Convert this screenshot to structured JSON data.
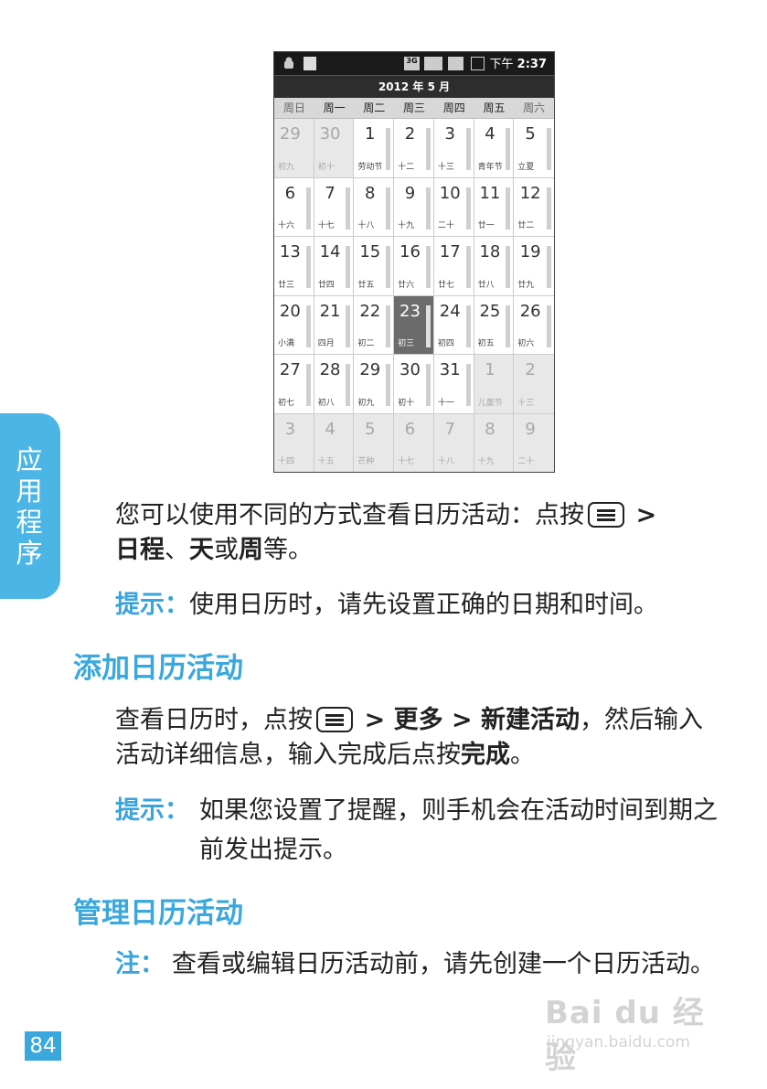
{
  "phone": {
    "statusbar": {
      "network": "3G",
      "time_prefix": "下午",
      "time": "2:37"
    },
    "month_title": "2012 年 5 月",
    "weekdays": [
      "周日",
      "周一",
      "周二",
      "周三",
      "周四",
      "周五",
      "周六"
    ],
    "weeks": [
      [
        {
          "d": "29",
          "l": "初九",
          "o": true
        },
        {
          "d": "30",
          "l": "初十",
          "o": true
        },
        {
          "d": "1",
          "l": "劳动节"
        },
        {
          "d": "2",
          "l": "十二"
        },
        {
          "d": "3",
          "l": "十三"
        },
        {
          "d": "4",
          "l": "青年节"
        },
        {
          "d": "5",
          "l": "立夏"
        }
      ],
      [
        {
          "d": "6",
          "l": "十六"
        },
        {
          "d": "7",
          "l": "十七"
        },
        {
          "d": "8",
          "l": "十八"
        },
        {
          "d": "9",
          "l": "十九"
        },
        {
          "d": "10",
          "l": "二十"
        },
        {
          "d": "11",
          "l": "廿一"
        },
        {
          "d": "12",
          "l": "廿二"
        }
      ],
      [
        {
          "d": "13",
          "l": "廿三"
        },
        {
          "d": "14",
          "l": "廿四"
        },
        {
          "d": "15",
          "l": "廿五"
        },
        {
          "d": "16",
          "l": "廿六"
        },
        {
          "d": "17",
          "l": "廿七"
        },
        {
          "d": "18",
          "l": "廿八"
        },
        {
          "d": "19",
          "l": "廿九"
        }
      ],
      [
        {
          "d": "20",
          "l": "小满"
        },
        {
          "d": "21",
          "l": "四月"
        },
        {
          "d": "22",
          "l": "初二"
        },
        {
          "d": "23",
          "l": "初三",
          "t": true
        },
        {
          "d": "24",
          "l": "初四"
        },
        {
          "d": "25",
          "l": "初五"
        },
        {
          "d": "26",
          "l": "初六"
        }
      ],
      [
        {
          "d": "27",
          "l": "初七"
        },
        {
          "d": "28",
          "l": "初八"
        },
        {
          "d": "29",
          "l": "初九"
        },
        {
          "d": "30",
          "l": "初十"
        },
        {
          "d": "31",
          "l": "十一"
        },
        {
          "d": "1",
          "l": "儿童节",
          "o": true
        },
        {
          "d": "2",
          "l": "十三",
          "o": true
        }
      ],
      [
        {
          "d": "3",
          "l": "十四",
          "o": true
        },
        {
          "d": "4",
          "l": "十五",
          "o": true
        },
        {
          "d": "5",
          "l": "芒种",
          "o": true
        },
        {
          "d": "6",
          "l": "十七",
          "o": true
        },
        {
          "d": "7",
          "l": "十八",
          "o": true
        },
        {
          "d": "8",
          "l": "十九",
          "o": true
        },
        {
          "d": "9",
          "l": "二十",
          "o": true
        }
      ]
    ]
  },
  "sidetab": "应用程序",
  "intro": {
    "p1": "您可以使用不同的方式查看日历活动：点按",
    "p2": ">",
    "p3": "日程",
    "p4": "、",
    "p5": "天",
    "p6": "或",
    "p7": "周",
    "p8": "等。"
  },
  "tip1": {
    "label": "提示：",
    "text": "使用日历时，请先设置正确的日期和时间。"
  },
  "section1": {
    "heading": "添加日历活动",
    "p1": "查看日历时，点按",
    "p2": "> 更多 > 新建活动",
    "p3": "，然后输入活动详细信息，输入完成后点按",
    "p4": "完成",
    "p5": "。"
  },
  "tip2": {
    "label": "提示：",
    "text": "如果您设置了提醒，则手机会在活动时间到期之前发出提示。"
  },
  "section2": {
    "heading": "管理日历活动"
  },
  "note": {
    "label": "注：",
    "text": "查看或编辑日历活动前，请先创建一个日历活动。"
  },
  "page_number": "84",
  "watermark": {
    "brand": "Bai du 经验",
    "url": "jingyan.baidu.com"
  }
}
